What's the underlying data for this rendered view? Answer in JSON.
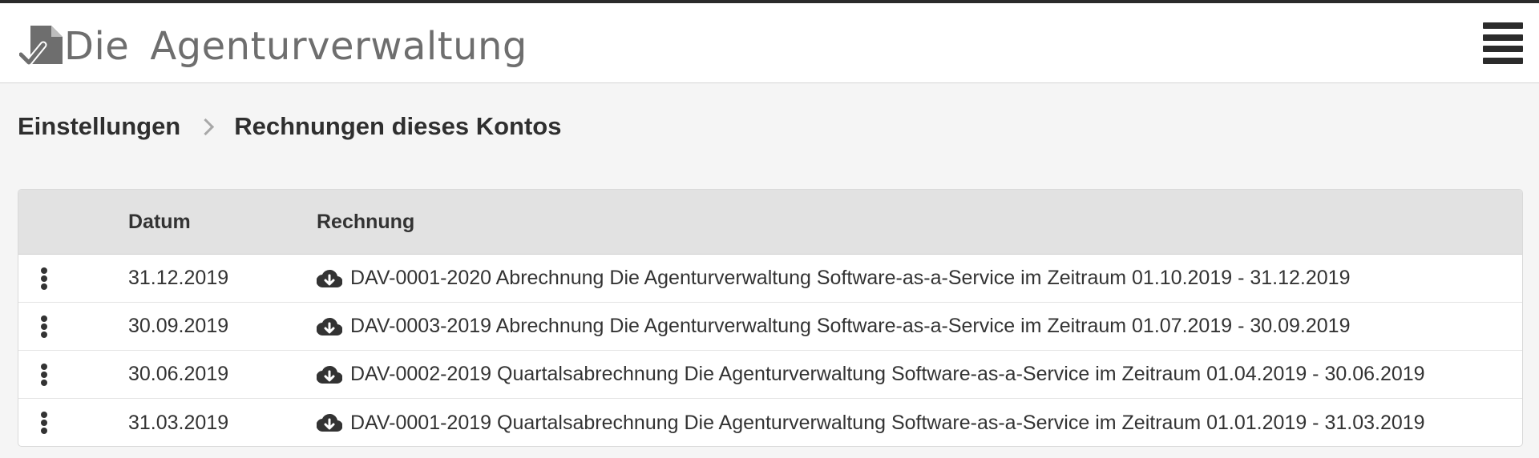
{
  "header": {
    "logo_word1": "Die",
    "logo_word2": "Agenturverwaltung",
    "menu_icon": "hamburger-menu-icon"
  },
  "breadcrumb": {
    "parent": "Einstellungen",
    "current": "Rechnungen dieses Kontos"
  },
  "table": {
    "columns": [
      "",
      "Datum",
      "Rechnung"
    ],
    "rows": [
      {
        "date": "31.12.2019",
        "invoice": "DAV-0001-2020 Abrechnung Die Agenturverwaltung Software-as-a-Service im Zeitraum 01.10.2019 - 31.12.2019"
      },
      {
        "date": "30.09.2019",
        "invoice": "DAV-0003-2019 Abrechnung Die Agenturverwaltung Software-as-a-Service im Zeitraum 01.07.2019 - 30.09.2019"
      },
      {
        "date": "30.06.2019",
        "invoice": "DAV-0002-2019 Quartalsabrechnung Die Agenturverwaltung Software-as-a-Service im Zeitraum 01.04.2019 - 30.06.2019"
      },
      {
        "date": "31.03.2019",
        "invoice": "DAV-0001-2019 Quartalsabrechnung Die Agenturverwaltung Software-as-a-Service im Zeitraum 01.01.2019 - 31.03.2019"
      }
    ]
  },
  "colors": {
    "topbar": "#2b2b2b",
    "header_bg": "#ffffff",
    "page_bg": "#f5f5f5",
    "table_header_bg": "#e2e2e2",
    "text": "#333333",
    "logo_gray": "#6e6e6e"
  }
}
